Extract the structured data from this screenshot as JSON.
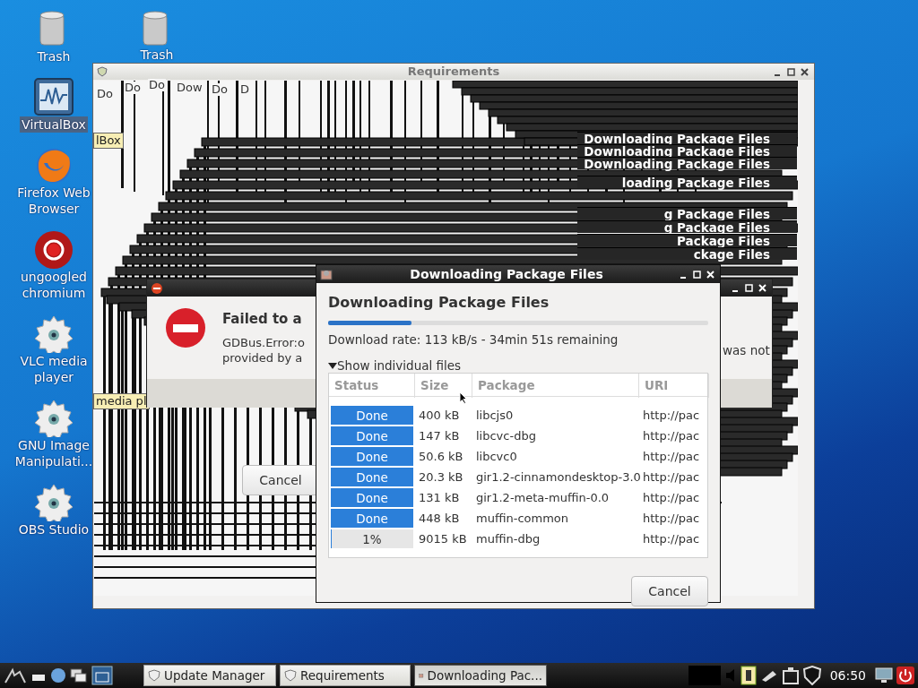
{
  "desktop_icons": [
    {
      "kind": "trash",
      "lines": [
        "Trash"
      ],
      "selected": false
    },
    {
      "kind": "virtualbox",
      "lines": [
        "VirtualBox"
      ],
      "selected": true
    },
    {
      "kind": "firefox",
      "lines": [
        "Firefox Web",
        "Browser"
      ],
      "selected": false
    },
    {
      "kind": "chromium",
      "lines": [
        "ungoogled",
        "chromium"
      ],
      "selected": false
    },
    {
      "kind": "gear",
      "lines": [
        "VLC media",
        "player"
      ],
      "selected": false
    },
    {
      "kind": "gear",
      "lines": [
        "GNU Image",
        "Manipulati..."
      ],
      "selected": false
    },
    {
      "kind": "gear",
      "lines": [
        "OBS Studio"
      ],
      "selected": false
    }
  ],
  "second_trash": {
    "label": "Trash"
  },
  "tooltips": [
    "lBox",
    "media pl"
  ],
  "requirements_window": {
    "title": "Requirements",
    "ghost_fragments": [
      "Do",
      "Do",
      "Do",
      "Dow",
      "Do",
      "D"
    ],
    "ghost_titles": [
      "Downloading Package Files",
      "Downloading Package Files",
      "Downloading Package Files",
      "loading Package Files",
      "g Package Files",
      "g Package Files",
      "Package Files",
      "ckage Files"
    ],
    "cancel_button": "Cancel"
  },
  "error_dialog": {
    "heading": "Failed to a",
    "lines": [
      "GDBus.Error:o",
      "provided by a"
    ],
    "tail": "was not"
  },
  "download_dialog": {
    "title": "Downloading Package Files",
    "heading": "Downloading Package Files",
    "level": 0.22,
    "rate": "Download rate: 113 kB/s - 34min 51s remaining",
    "expander": {
      "label": "Show individual files",
      "expanded": true
    },
    "columns": [
      "Status",
      "Size",
      "Package",
      "URI"
    ],
    "rows": [
      {
        "status": "Done",
        "level": 1,
        "size": "400 kB",
        "package": "libcjs0",
        "uri": "http://pac"
      },
      {
        "status": "Done",
        "level": 1,
        "size": "147 kB",
        "package": "libcvc-dbg",
        "uri": "http://pac"
      },
      {
        "status": "Done",
        "level": 1,
        "size": "50.6 kB",
        "package": "libcvc0",
        "uri": "http://pac"
      },
      {
        "status": "Done",
        "level": 1,
        "size": "20.3 kB",
        "package": "gir1.2-cinnamondesktop-3.0",
        "uri": "http://pac"
      },
      {
        "status": "Done",
        "level": 1,
        "size": "131 kB",
        "package": "gir1.2-meta-muffin-0.0",
        "uri": "http://pac"
      },
      {
        "status": "Done",
        "level": 1,
        "size": "448 kB",
        "package": "muffin-common",
        "uri": "http://pac"
      },
      {
        "status": "1%",
        "level": 0.01,
        "size": "9015 kB",
        "package": "muffin-dbg",
        "uri": "http://pac"
      }
    ],
    "cancel_button": "Cancel"
  },
  "taskbar": {
    "tasks": [
      {
        "kind": "shield",
        "label": "Update Manager",
        "selected": false
      },
      {
        "kind": "shield",
        "label": "Requirements",
        "selected": false
      },
      {
        "kind": "package",
        "label": "Downloading Pac...",
        "selected": true
      }
    ],
    "clock": "06:50"
  }
}
